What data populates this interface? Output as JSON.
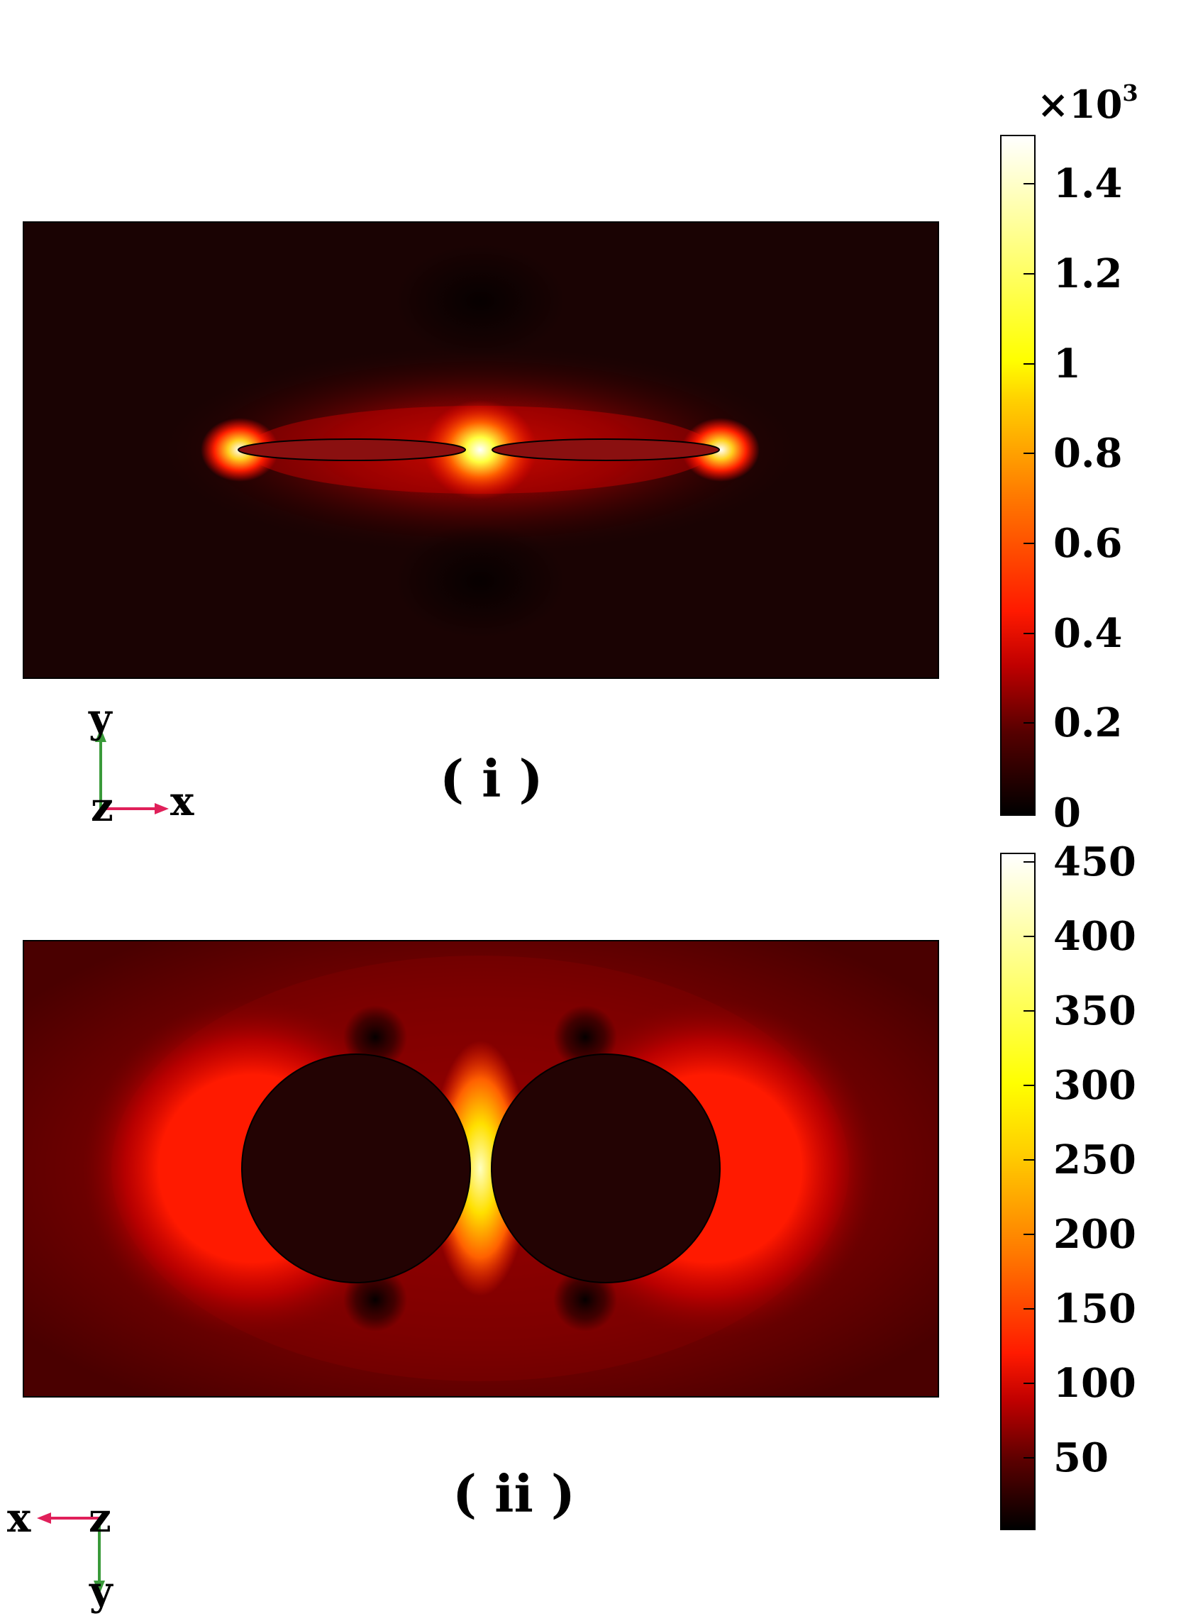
{
  "chart_data": [
    {
      "type": "heatmap",
      "panel_label": "( i )",
      "colorbar": {
        "multiplier_base": "×10",
        "multiplier_exp": "3",
        "min": 0,
        "max": 1.5,
        "tick_labels": [
          "1.4",
          "1.2",
          "1",
          "0.8",
          "0.6",
          "0.4",
          "0.2",
          "0"
        ],
        "tick_values": [
          1.4,
          1.2,
          1.0,
          0.8,
          0.6,
          0.4,
          0.2,
          0.0
        ]
      },
      "axes": {
        "vertical": "y",
        "horizontal": "x",
        "out_of_plane": "z"
      },
      "colormap": [
        "#000000",
        "#5a0000",
        "#c80000",
        "#ff2000",
        "#ff8000",
        "#ffff00",
        "#ffffff"
      ]
    },
    {
      "type": "heatmap",
      "panel_label": "( ii )",
      "colorbar": {
        "min": 0,
        "max": 460,
        "tick_labels": [
          "450",
          "400",
          "350",
          "300",
          "250",
          "200",
          "150",
          "100",
          "50"
        ],
        "tick_values": [
          450,
          400,
          350,
          300,
          250,
          200,
          150,
          100,
          50
        ]
      },
      "axes": {
        "vertical": "y",
        "horizontal": "x",
        "out_of_plane": "z"
      },
      "colormap": [
        "#000000",
        "#5a0000",
        "#c80000",
        "#ff2000",
        "#ff8000",
        "#ffff00",
        "#ffffff"
      ]
    }
  ]
}
